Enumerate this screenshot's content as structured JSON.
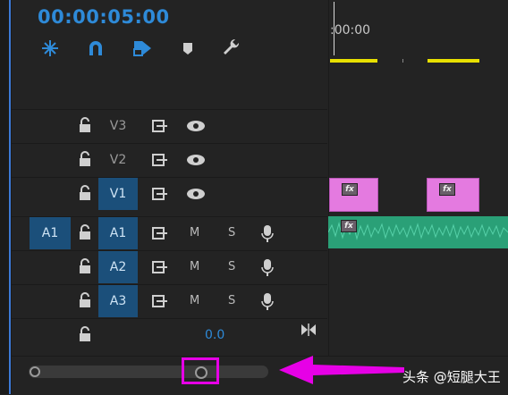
{
  "timecode": "00:00:05:00",
  "toolbar": {
    "tools": [
      {
        "name": "snap-insert-icon"
      },
      {
        "name": "magnet-icon"
      },
      {
        "name": "linked-selection-icon"
      },
      {
        "name": "add-marker-icon"
      },
      {
        "name": "wrench-icon"
      }
    ]
  },
  "tracks": [
    {
      "name": "V3",
      "type": "video",
      "active": false
    },
    {
      "name": "V2",
      "type": "video",
      "active": false
    },
    {
      "name": "V1",
      "type": "video",
      "active": true
    },
    {
      "name": "A1",
      "type": "audio",
      "active": true,
      "source": "A1",
      "m": "M",
      "s": "S"
    },
    {
      "name": "A2",
      "type": "audio",
      "active": true,
      "m": "M",
      "s": "S"
    },
    {
      "name": "A3",
      "type": "audio",
      "active": true,
      "m": "M",
      "s": "S"
    }
  ],
  "master": {
    "value": "0.0"
  },
  "ruler": {
    "label": ":00:00"
  },
  "clips": {
    "fx_label": "fx"
  },
  "colors": {
    "accent": "#2e8ad8",
    "track_active": "#1b4f7a",
    "video_clip": "#e47ae0",
    "audio_clip": "#2aa077",
    "annotation": "#e600e6",
    "ruler_marker": "#e8e000"
  },
  "watermark": "头条 @短腿大王"
}
